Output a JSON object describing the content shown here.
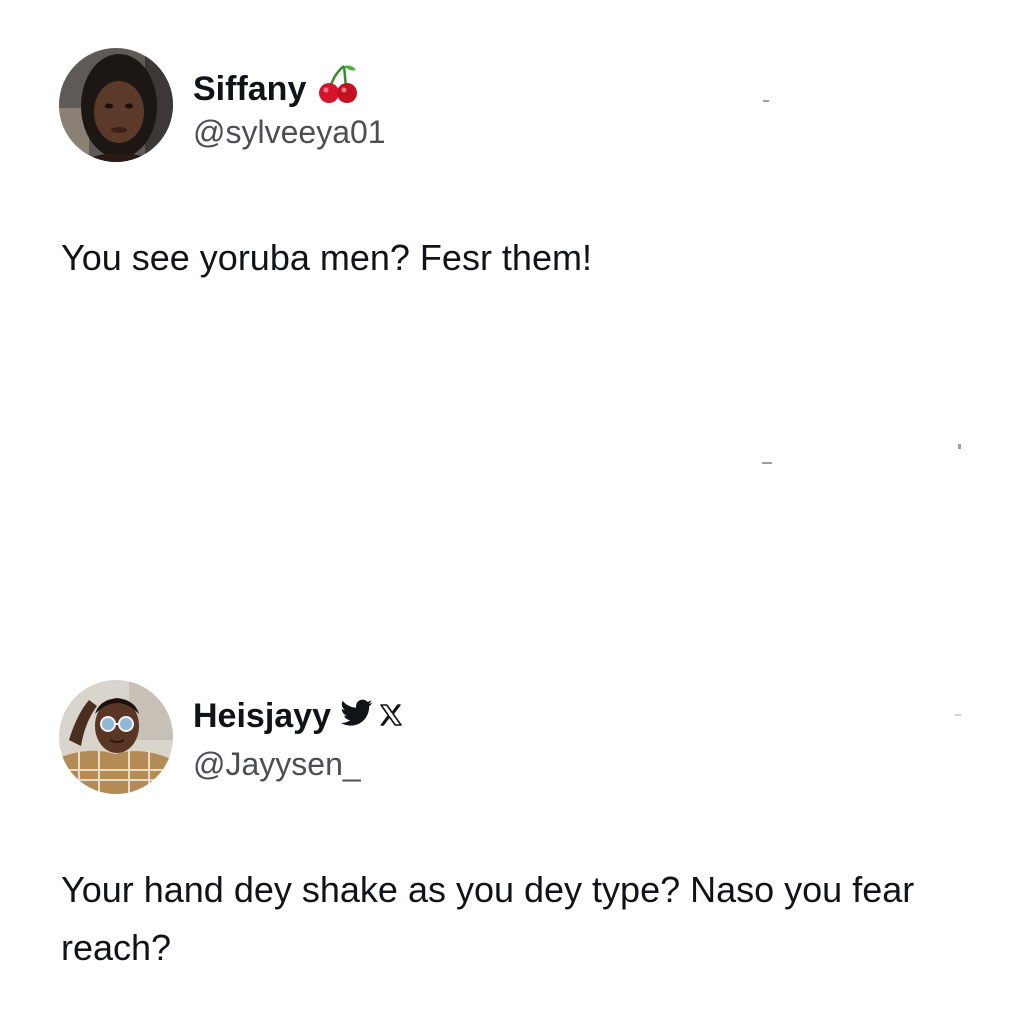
{
  "tweets": [
    {
      "display_name": "Siffany",
      "name_icon": "cherries-emoji",
      "handle": "@sylveeya01",
      "text": "You see yoruba men? Fesr them!"
    },
    {
      "display_name": "Heisjayy",
      "name_icon": "twitter-bird-and-x-logo",
      "handle": "@Jayysen_",
      "text": "Your hand dey shake as you dey type? Naso you fear reach?"
    }
  ],
  "colors": {
    "background": "#ffffff",
    "text": "#0f1419",
    "handle": "#4a4f55",
    "twitter_bird": "#0f1419"
  }
}
